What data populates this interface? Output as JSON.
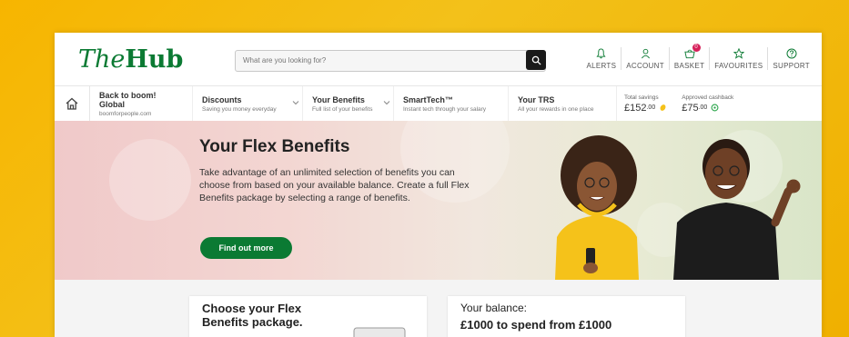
{
  "brand": {
    "logo_the": "The",
    "logo_hub": "Hub"
  },
  "search": {
    "placeholder": "What are you looking for?"
  },
  "top_links": [
    {
      "label": "ALERTS",
      "icon": "bell-icon"
    },
    {
      "label": "ACCOUNT",
      "icon": "user-icon"
    },
    {
      "label": "BASKET",
      "icon": "basket-icon",
      "badge": "0"
    },
    {
      "label": "FAVOURITES",
      "icon": "star-icon"
    },
    {
      "label": "SUPPORT",
      "icon": "help-icon"
    }
  ],
  "nav": {
    "items": [
      {
        "title": "Back to boom! Global",
        "subtitle": "boomforpeople.com"
      },
      {
        "title": "Discounts",
        "subtitle": "Saving you money everyday"
      },
      {
        "title": "Your Benefits",
        "subtitle": "Full list of your benefits"
      },
      {
        "title": "SmartTech™",
        "subtitle": "Instant tech through your salary"
      },
      {
        "title": "Your TRS",
        "subtitle": "All your rewards in one place"
      }
    ],
    "total_savings": {
      "label": "Total savings",
      "whole": "£152",
      "decimal": ".00"
    },
    "cashback": {
      "label": "Approved cashback",
      "whole": "£75",
      "decimal": ".00"
    }
  },
  "hero": {
    "title": "Your Flex Benefits",
    "text": "Take advantage of an unlimited selection of benefits you can choose from based on your available balance. Create a full Flex Benefits package by selecting a range of benefits.",
    "cta": "Find out more"
  },
  "cards": {
    "package_title": "Choose your Flex Benefits package.",
    "balance_label": "Your balance:",
    "balance_value": "£1000 to spend from £1000"
  },
  "colors": {
    "brand_green": "#0b7a33",
    "page_yellow": "#f7b500",
    "badge": "#d6205a"
  }
}
